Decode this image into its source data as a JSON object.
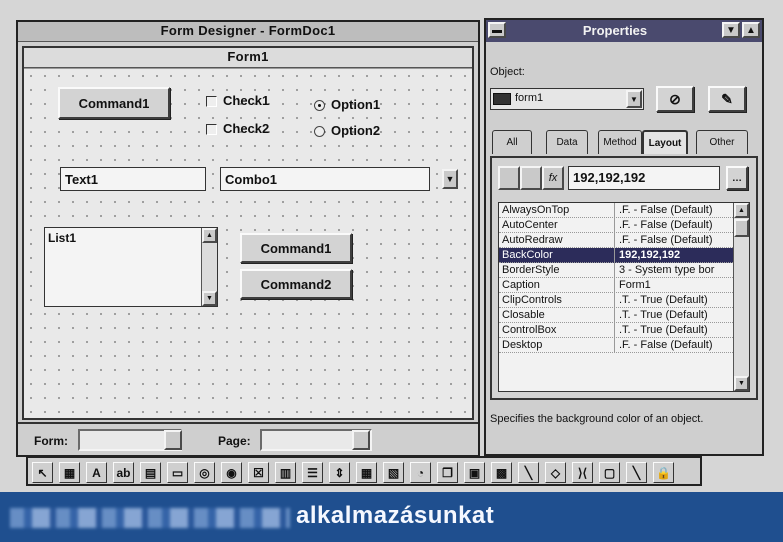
{
  "form_designer": {
    "title": "Form Designer - FormDoc1",
    "form_title": "Form1",
    "controls": {
      "command1_top": "Command1",
      "check1": "Check1",
      "check2": "Check2",
      "option1": "Option1",
      "option2": "Option2",
      "text1": "Text1",
      "combo1": "Combo1",
      "list1": "List1",
      "command1": "Command1",
      "command2": "Command2"
    },
    "status": {
      "form_label": "Form:",
      "page_label": "Page:"
    }
  },
  "properties": {
    "title": "Properties",
    "object_label": "Object:",
    "object_value": "form1",
    "tabs": [
      "All",
      "Data",
      "Method",
      "Layout",
      "Other"
    ],
    "active_tab": "Layout",
    "edit_value": "192,192,192",
    "rows": [
      {
        "name": "AlwaysOnTop",
        "value": ".F. - False (Default)"
      },
      {
        "name": "AutoCenter",
        "value": ".F. - False (Default)"
      },
      {
        "name": "AutoRedraw",
        "value": ".F. - False (Default)"
      },
      {
        "name": "BackColor",
        "value": "192,192,192"
      },
      {
        "name": "BorderStyle",
        "value": "3 - System type bor"
      },
      {
        "name": "Caption",
        "value": "Form1"
      },
      {
        "name": "ClipControls",
        "value": ".T. - True (Default)"
      },
      {
        "name": "Closable",
        "value": ".T. - True (Default)"
      },
      {
        "name": "ControlBox",
        "value": ".T. - True (Default)"
      },
      {
        "name": "Desktop",
        "value": ".F. - False (Default)"
      }
    ],
    "selected_row": "BackColor",
    "description": "Specifies the background color of an object."
  },
  "toolbar": {
    "icons": [
      "pointer-icon",
      "view-classes-icon",
      "label-icon",
      "textbox-icon",
      "editbox-icon",
      "commandbutton-icon",
      "commandgroup-icon",
      "optiongroup-icon",
      "checkbox-icon",
      "combobox-icon",
      "listbox-icon",
      "spinner-icon",
      "grid-icon",
      "image-icon",
      "timer-icon",
      "pageframe-icon",
      "oleobject-icon",
      "oleboundcontrol-icon",
      "line-icon",
      "shape-icon",
      "separator-icon",
      "container-icon",
      "builder-lock-icon",
      "button-lock-icon"
    ],
    "glyphs": [
      "↖",
      "▦",
      "A",
      "ab",
      "▤",
      "▭",
      "◎",
      "◉",
      "☒",
      "▥",
      "☰",
      "⇕",
      "▦",
      "▧",
      "◔",
      "❐",
      "▣",
      "▩",
      "╲",
      "◇",
      "⟩⟨",
      "▢",
      "╲",
      "🔒"
    ]
  },
  "banner": {
    "text": "alkalmazásunkat",
    "color": "#1f4f8f"
  }
}
